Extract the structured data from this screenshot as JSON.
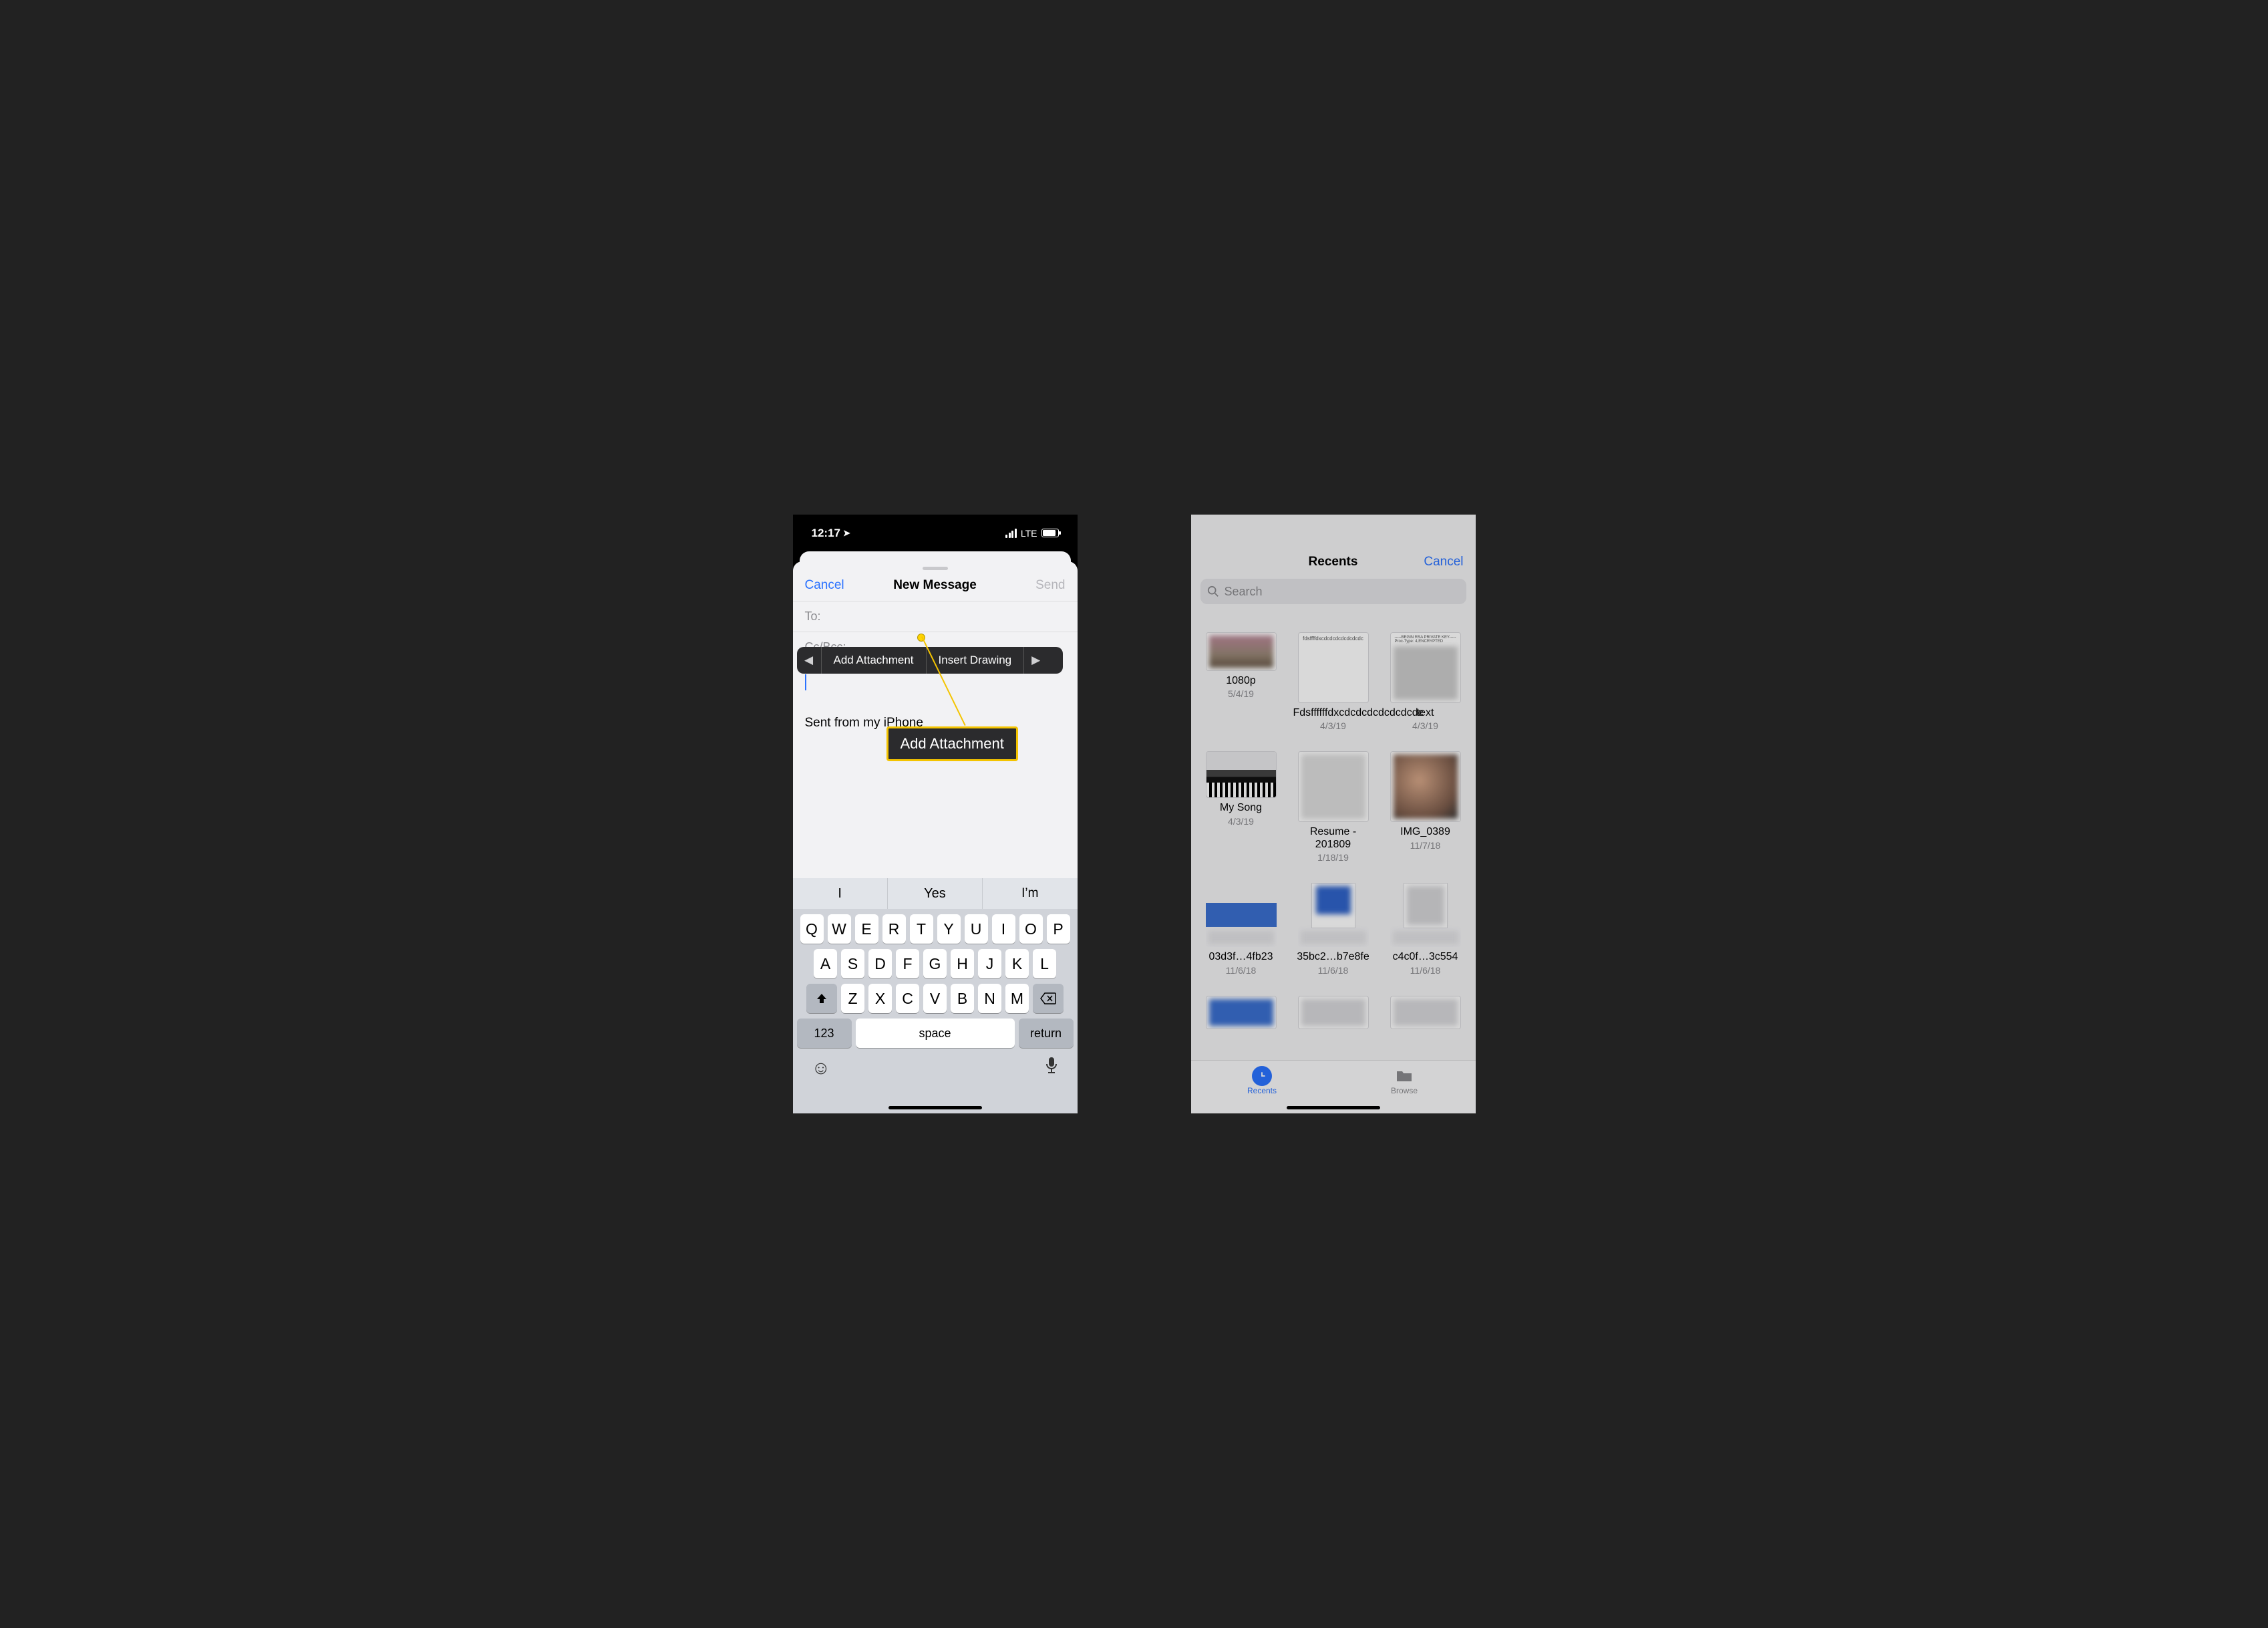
{
  "phone1": {
    "status": {
      "time": "12:17",
      "network": "LTE"
    },
    "nav": {
      "cancel": "Cancel",
      "title": "New Message",
      "send": "Send"
    },
    "fields": {
      "to": "To:",
      "ccbcc": "Cc/Bcc:"
    },
    "editmenu": {
      "add_attachment": "Add Attachment",
      "insert_drawing": "Insert Drawing"
    },
    "signature": "Sent from my iPhone",
    "callout_label": "Add Attachment",
    "keyboard": {
      "predict": [
        "I",
        "Yes",
        "I’m"
      ],
      "row1": [
        "Q",
        "W",
        "E",
        "R",
        "T",
        "Y",
        "U",
        "I",
        "O",
        "P"
      ],
      "row2": [
        "A",
        "S",
        "D",
        "F",
        "G",
        "H",
        "J",
        "K",
        "L"
      ],
      "row3": [
        "Z",
        "X",
        "C",
        "V",
        "B",
        "N",
        "M"
      ],
      "numbers": "123",
      "space": "space",
      "ret": "return"
    }
  },
  "phone2": {
    "nav": {
      "title": "Recents",
      "cancel": "Cancel"
    },
    "search_placeholder": "Search",
    "files": [
      {
        "name": "1080p",
        "date": "5/4/19"
      },
      {
        "name": "Fdsffffffdxcdcdcdcdcdcdcdc",
        "date": "4/3/19"
      },
      {
        "name": "text",
        "date": "4/3/19"
      },
      {
        "name": "My Song",
        "date": "4/3/19"
      },
      {
        "name": "Resume - 201809",
        "date": "1/18/19"
      },
      {
        "name": "IMG_0389",
        "date": "11/7/18"
      },
      {
        "name": "03d3f…4fb23",
        "date": "11/6/18"
      },
      {
        "name": "35bc2…b7e8fe",
        "date": "11/6/18"
      },
      {
        "name": "c4c0f…3c554",
        "date": "11/6/18"
      }
    ],
    "tabs": {
      "recents": "Recents",
      "browse": "Browse"
    }
  }
}
